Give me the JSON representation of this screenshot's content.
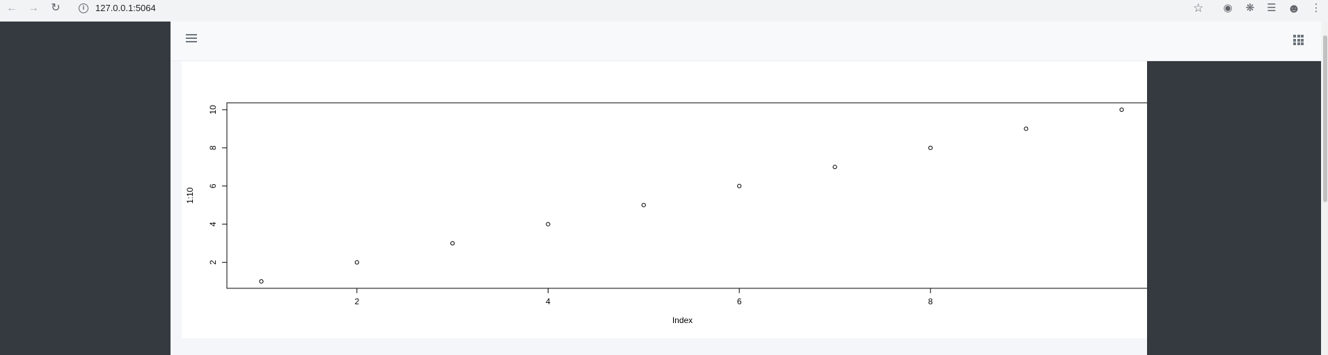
{
  "browser": {
    "url": "127.0.0.1:5064",
    "icons": [
      "back-icon",
      "forward-icon",
      "reload-icon",
      "info-icon",
      "star-icon",
      "extension-icon",
      "puzzle-icon",
      "media-icon",
      "profile-icon",
      "menu-icon"
    ]
  },
  "colors": {
    "sidebar": "#343a40",
    "header": "#f8f9fa",
    "content_bg": "#f4f6f9",
    "plot_bg": "#ffffff",
    "ink": "#000000"
  },
  "chart_data": {
    "type": "scatter",
    "title": "",
    "xlabel": "Index",
    "ylabel": "1:10",
    "x": [
      1,
      2,
      3,
      4,
      5,
      6,
      7,
      8,
      9,
      10
    ],
    "y": [
      1,
      2,
      3,
      4,
      5,
      6,
      7,
      8,
      9,
      10
    ],
    "xlim": [
      0.64,
      10.36
    ],
    "ylim": [
      0.64,
      10.36
    ],
    "xticks": [
      2,
      4,
      6,
      8
    ],
    "yticks": [
      2,
      4,
      6,
      8,
      10
    ],
    "grid": false,
    "marker": "open-circle"
  }
}
